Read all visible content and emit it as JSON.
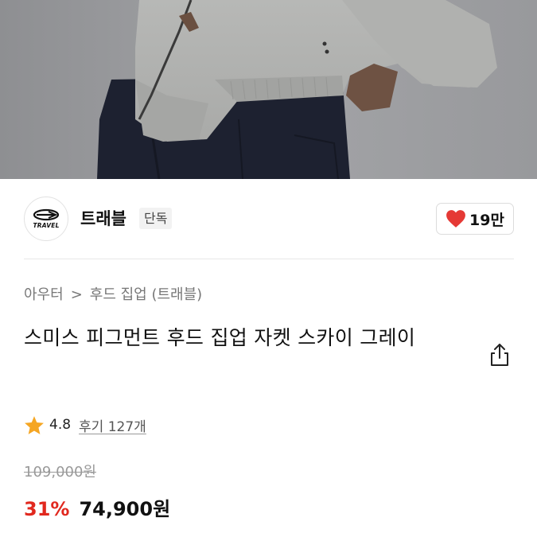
{
  "brand": {
    "logo_text": "TRAVEL",
    "name": "트래블",
    "badge": "단독",
    "likes": "19만"
  },
  "breadcrumb": {
    "category": "아우터",
    "separator": ">",
    "subcategory": "후드 집업 (트래블)"
  },
  "product": {
    "title": "스미스 피그먼트 후드 집업 자켓 스카이 그레이"
  },
  "rating": {
    "score": "4.8",
    "reviews": "후기 127개"
  },
  "price": {
    "original": "109,000원",
    "discount": "31%",
    "final": "74,900원"
  },
  "colors": {
    "discount": "#e1281e",
    "heart": "#e53935",
    "star": "#f5a623"
  },
  "icons": {
    "like": "heart-icon",
    "share": "share-icon",
    "rating": "star-icon"
  }
}
